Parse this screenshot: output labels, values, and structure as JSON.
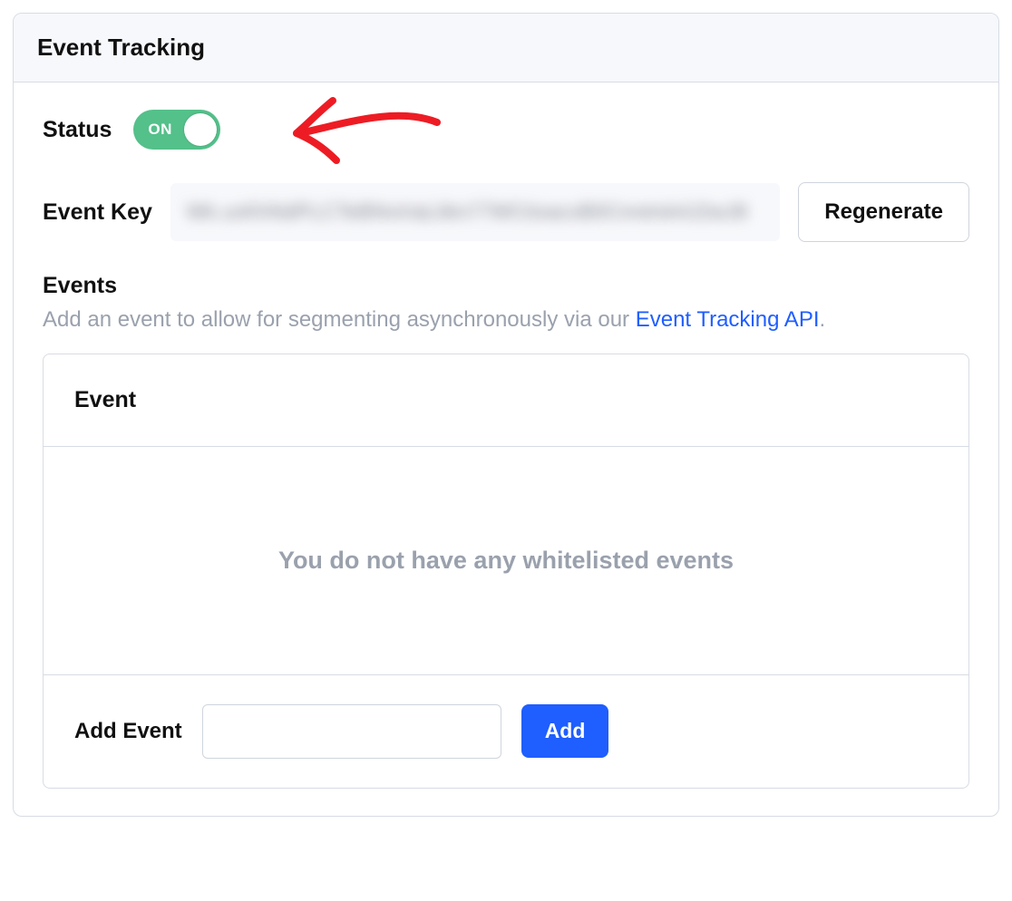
{
  "panel": {
    "title": "Event Tracking"
  },
  "status": {
    "label": "Status",
    "state_label": "ON"
  },
  "event_key": {
    "label": "Event Key",
    "value_masked": "Wk.uxKhNdPLCTeBNviriaLlikn77WCtixacxB0Cnretvk4J2wJ8",
    "regenerate_label": "Regenerate"
  },
  "events": {
    "section_title": "Events",
    "description_prefix": "Add an event to allow for segmenting asynchronously via our ",
    "link_text": "Event Tracking API",
    "description_suffix": ".",
    "table": {
      "header": "Event",
      "empty_message": "You do not have any whitelisted events",
      "add_label": "Add Event",
      "add_input_value": "",
      "add_button_label": "Add"
    }
  },
  "colors": {
    "toggle_on": "#54c08a",
    "primary_blue": "#1f5eff",
    "annotation_red": "#ed1c24"
  }
}
